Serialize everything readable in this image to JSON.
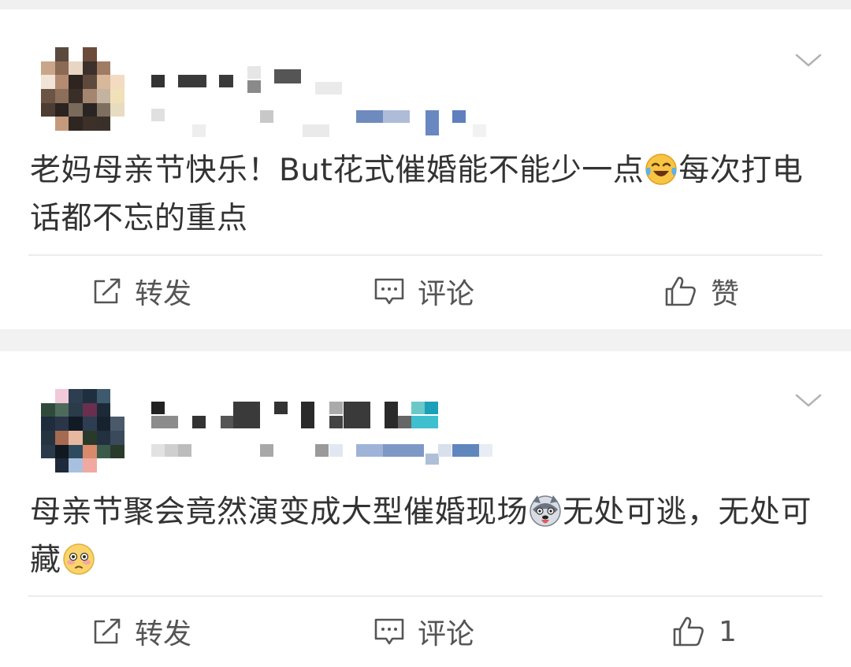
{
  "posts": [
    {
      "text_a": "老妈母亲节快乐！But花式催婚能不能少一点",
      "emoji_a": "crying-laughing-emoji",
      "text_b": "每次打电话都不忘的重点",
      "actions": {
        "repost": "转发",
        "comment": "评论",
        "like": "赞"
      }
    },
    {
      "text_a": "母亲节聚会竟然演变成大型催婚现场",
      "emoji_a": "husky-dog-emoji",
      "text_b": "无处可逃，无处可藏",
      "emoji_b": "flushed-face-emoji",
      "actions": {
        "repost": "转发",
        "comment": "评论",
        "like": "1"
      }
    }
  ],
  "colors": {
    "background": "#f2f2f2",
    "card": "#ffffff",
    "text": "#333333",
    "action_text": "#555555",
    "divider": "#ececec"
  }
}
